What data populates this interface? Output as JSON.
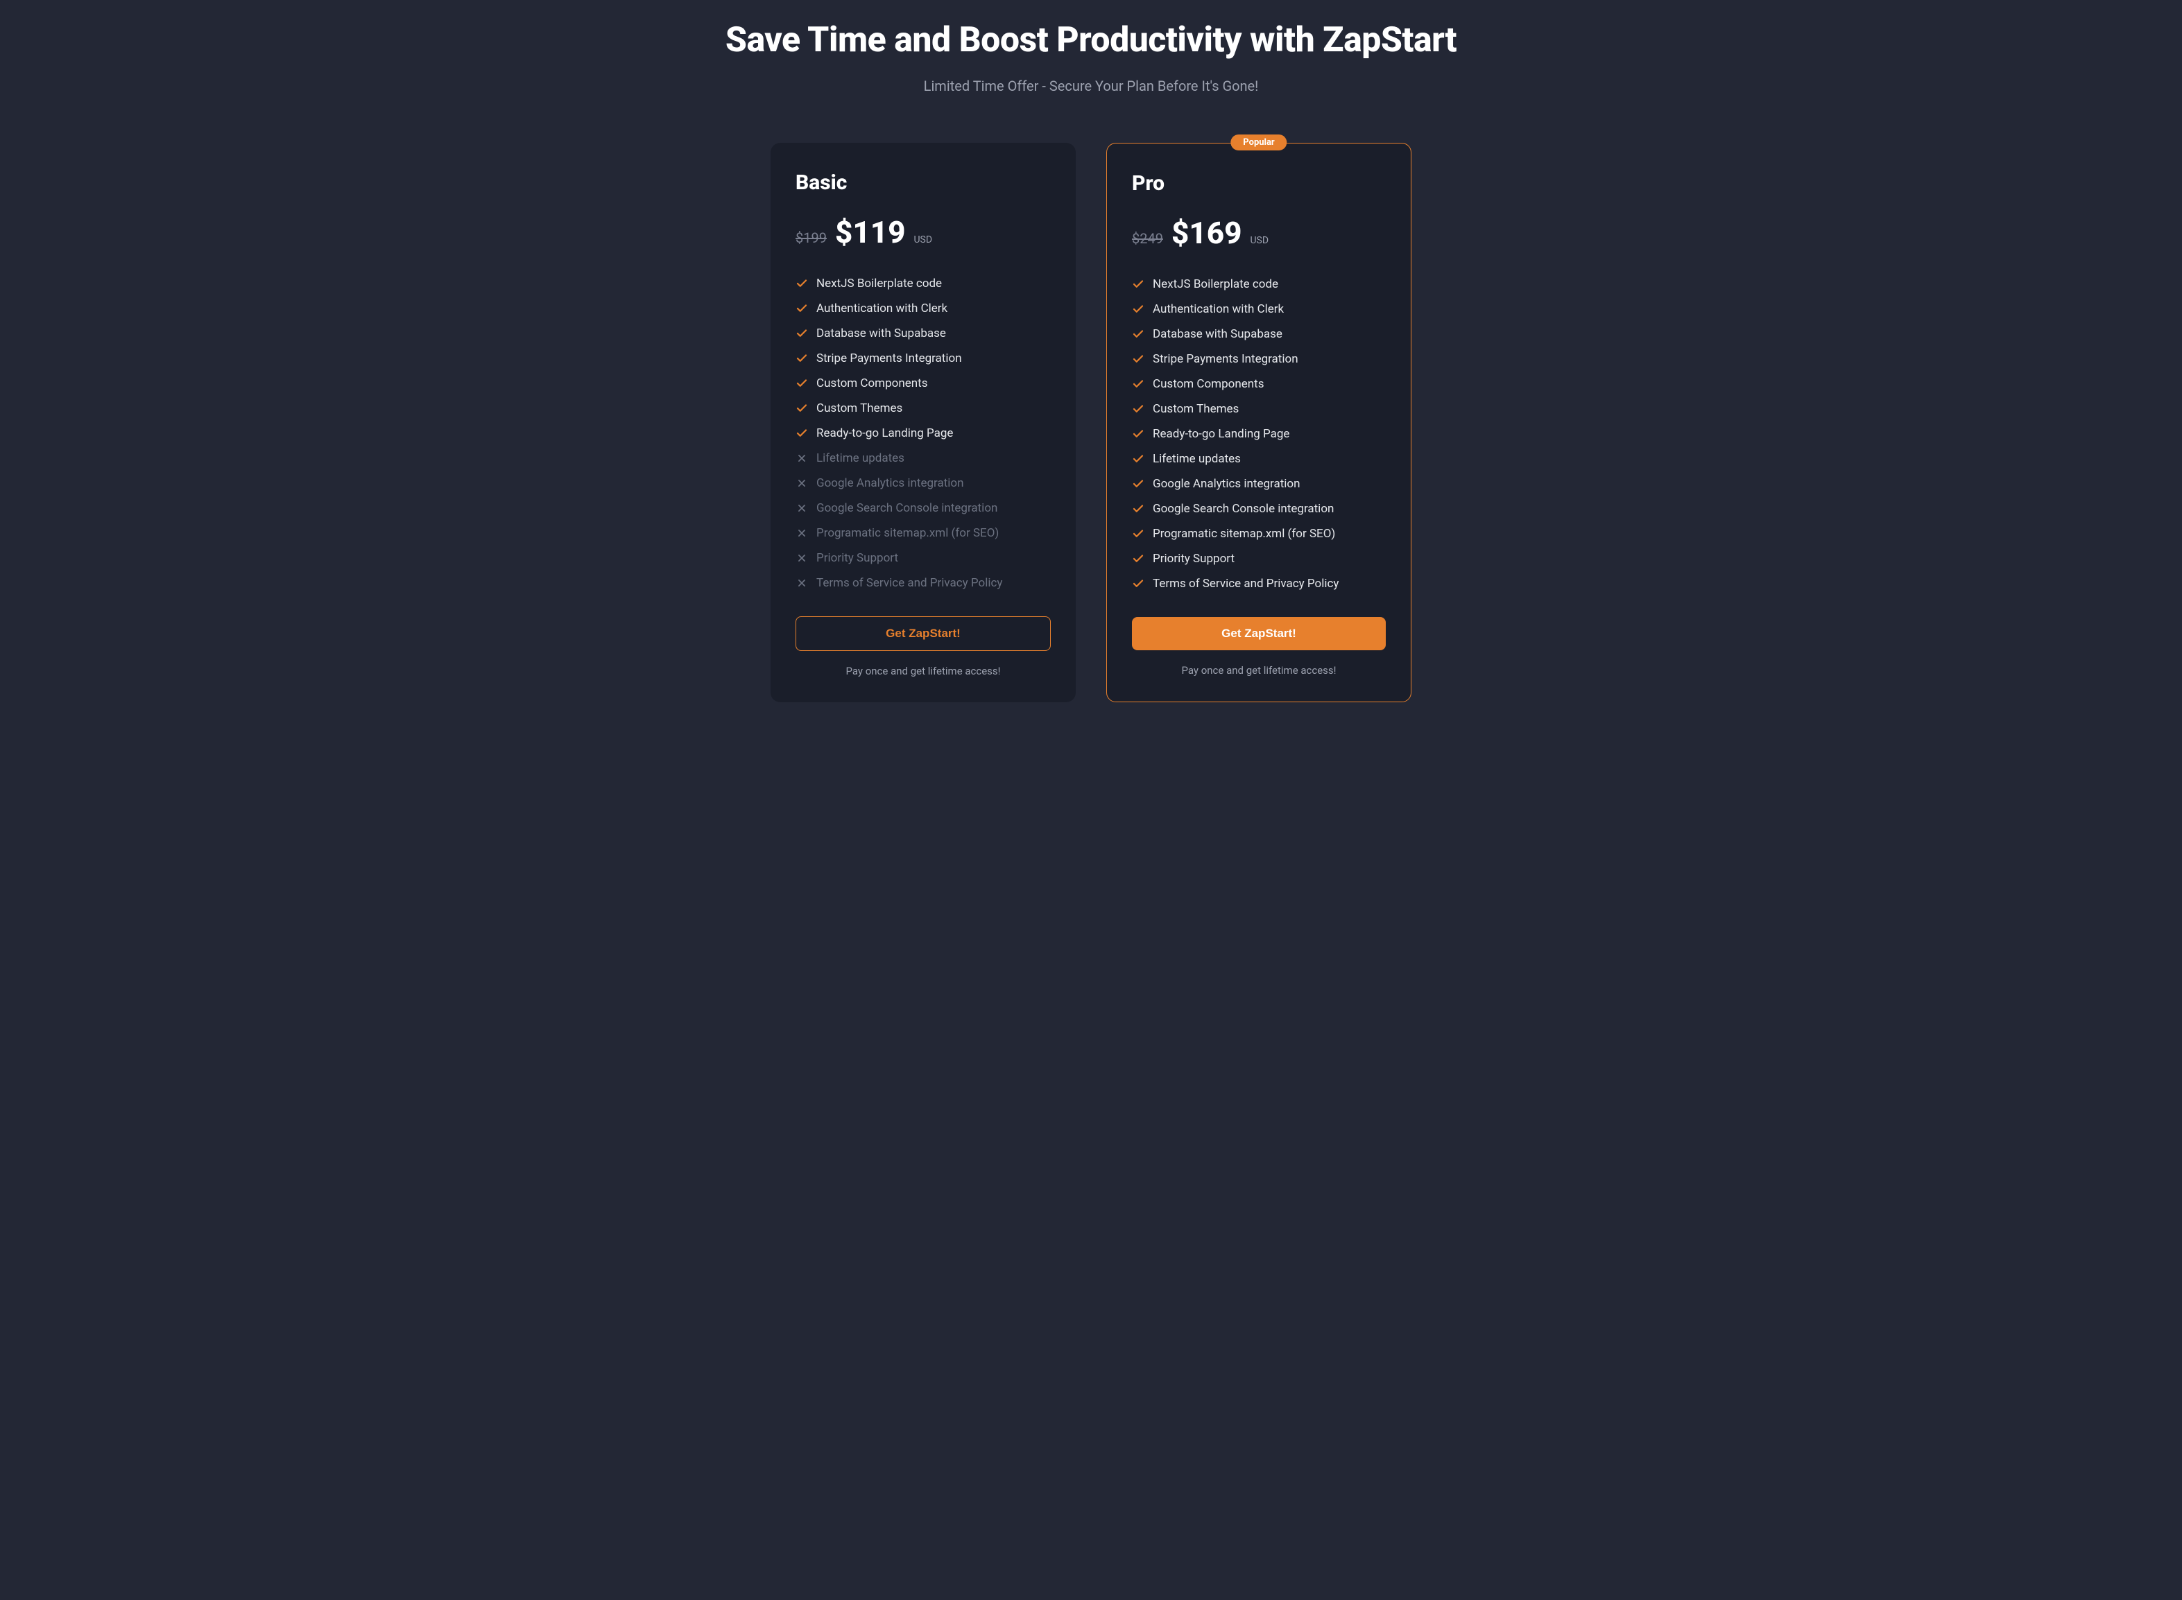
{
  "headline": "Save Time and Boost Productivity with ZapStart",
  "subheadline": "Limited Time Offer - Secure Your Plan Before It's Gone!",
  "popular_badge": "Popular",
  "currency_label": "USD",
  "features": [
    "NextJS Boilerplate code",
    "Authentication with Clerk",
    "Database with Supabase",
    "Stripe Payments Integration",
    "Custom Components",
    "Custom Themes",
    "Ready-to-go Landing Page",
    "Lifetime updates",
    "Google Analytics integration",
    "Google Search Console integration",
    "Programatic sitemap.xml (for SEO)",
    "Priority Support",
    "Terms of Service and Privacy Policy"
  ],
  "plans": [
    {
      "name": "Basic",
      "old_price": "$199",
      "price": "$119",
      "popular": false,
      "included_count": 7,
      "cta": "Get ZapStart!",
      "footnote": "Pay once and get lifetime access!"
    },
    {
      "name": "Pro",
      "old_price": "$249",
      "price": "$169",
      "popular": true,
      "included_count": 13,
      "cta": "Get ZapStart!",
      "footnote": "Pay once and get lifetime access!"
    }
  ],
  "colors": {
    "accent": "#e7802d"
  }
}
